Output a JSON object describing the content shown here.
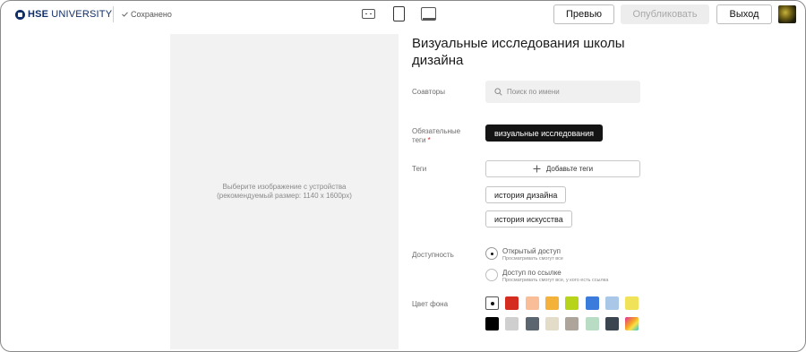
{
  "header": {
    "logo_strong": "HSE",
    "logo_light": "UNIVERSITY",
    "saved_label": "Сохранено",
    "preview_label": "Превью",
    "publish_label": "Опубликовать",
    "exit_label": "Выход"
  },
  "image_panel": {
    "hint_line1": "Выберите изображение с устройства",
    "hint_line2": "(рекомендуемый размер: 1140 x 1600px)"
  },
  "form": {
    "title": "Визуальные исследования школы дизайна",
    "coauthors_label": "Соавторы",
    "search_placeholder": "Поиск по имени",
    "required_tags_label": "Обязательные теги",
    "required_tag": "визуальные исследования",
    "tags_label": "Теги",
    "add_tags_label": "Добавьте теги",
    "tags": [
      "история дизайна",
      "история искусства"
    ],
    "access_label": "Доступность",
    "access_options": [
      {
        "title": "Открытый доступ",
        "subtitle": "Просматривать смогут все",
        "selected": true
      },
      {
        "title": "Доступ по ссылке",
        "subtitle": "Просматривать смогут все, у кого есть ссылка",
        "selected": false
      }
    ],
    "bg_color_label": "Цвет фона",
    "colors_row1": [
      "#ffffff",
      "#d42c1f",
      "#f9bd98",
      "#f4b23a",
      "#b7d31a",
      "#3b7bdc",
      "#a9c8e8",
      "#f0e35a"
    ],
    "colors_row2": [
      "#000000",
      "#cfcfcf",
      "#5a6570",
      "#e3dcc8",
      "#ada49a",
      "#b9dcc5",
      "#3a4550",
      "gradient"
    ],
    "selected_color": "#ffffff"
  }
}
